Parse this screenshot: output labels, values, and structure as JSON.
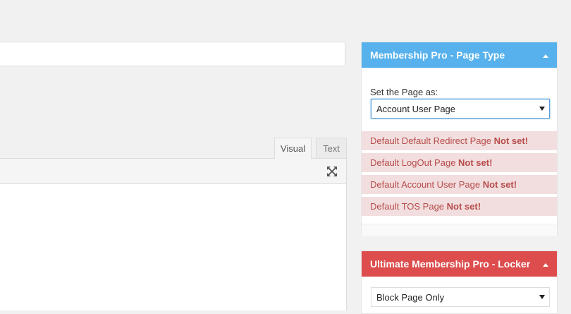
{
  "editor": {
    "title_value": "",
    "tabs": [
      {
        "label": "Visual"
      },
      {
        "label": "Text"
      }
    ],
    "fullscreen_icon": "expand-arrows-icon"
  },
  "page_type_box": {
    "title": "Membership Pro - Page Type",
    "header_color": "#56b1ec",
    "toggle_icon": "caret-up-icon",
    "set_label": "Set the Page as:",
    "select_value": "Account User Page",
    "notices": [
      {
        "text": "Default Default Redirect Page ",
        "status": "Not set!"
      },
      {
        "text": "Default LogOut Page ",
        "status": "Not set!"
      },
      {
        "text": "Default Account User Page ",
        "status": "Not set!"
      },
      {
        "text": "Default TOS Page ",
        "status": "Not set!"
      }
    ]
  },
  "locker_box": {
    "title": "Ultimate Membership Pro - Locker",
    "header_color": "#dd4d4d",
    "toggle_icon": "caret-up-icon",
    "select_value": "Block Page Only"
  }
}
